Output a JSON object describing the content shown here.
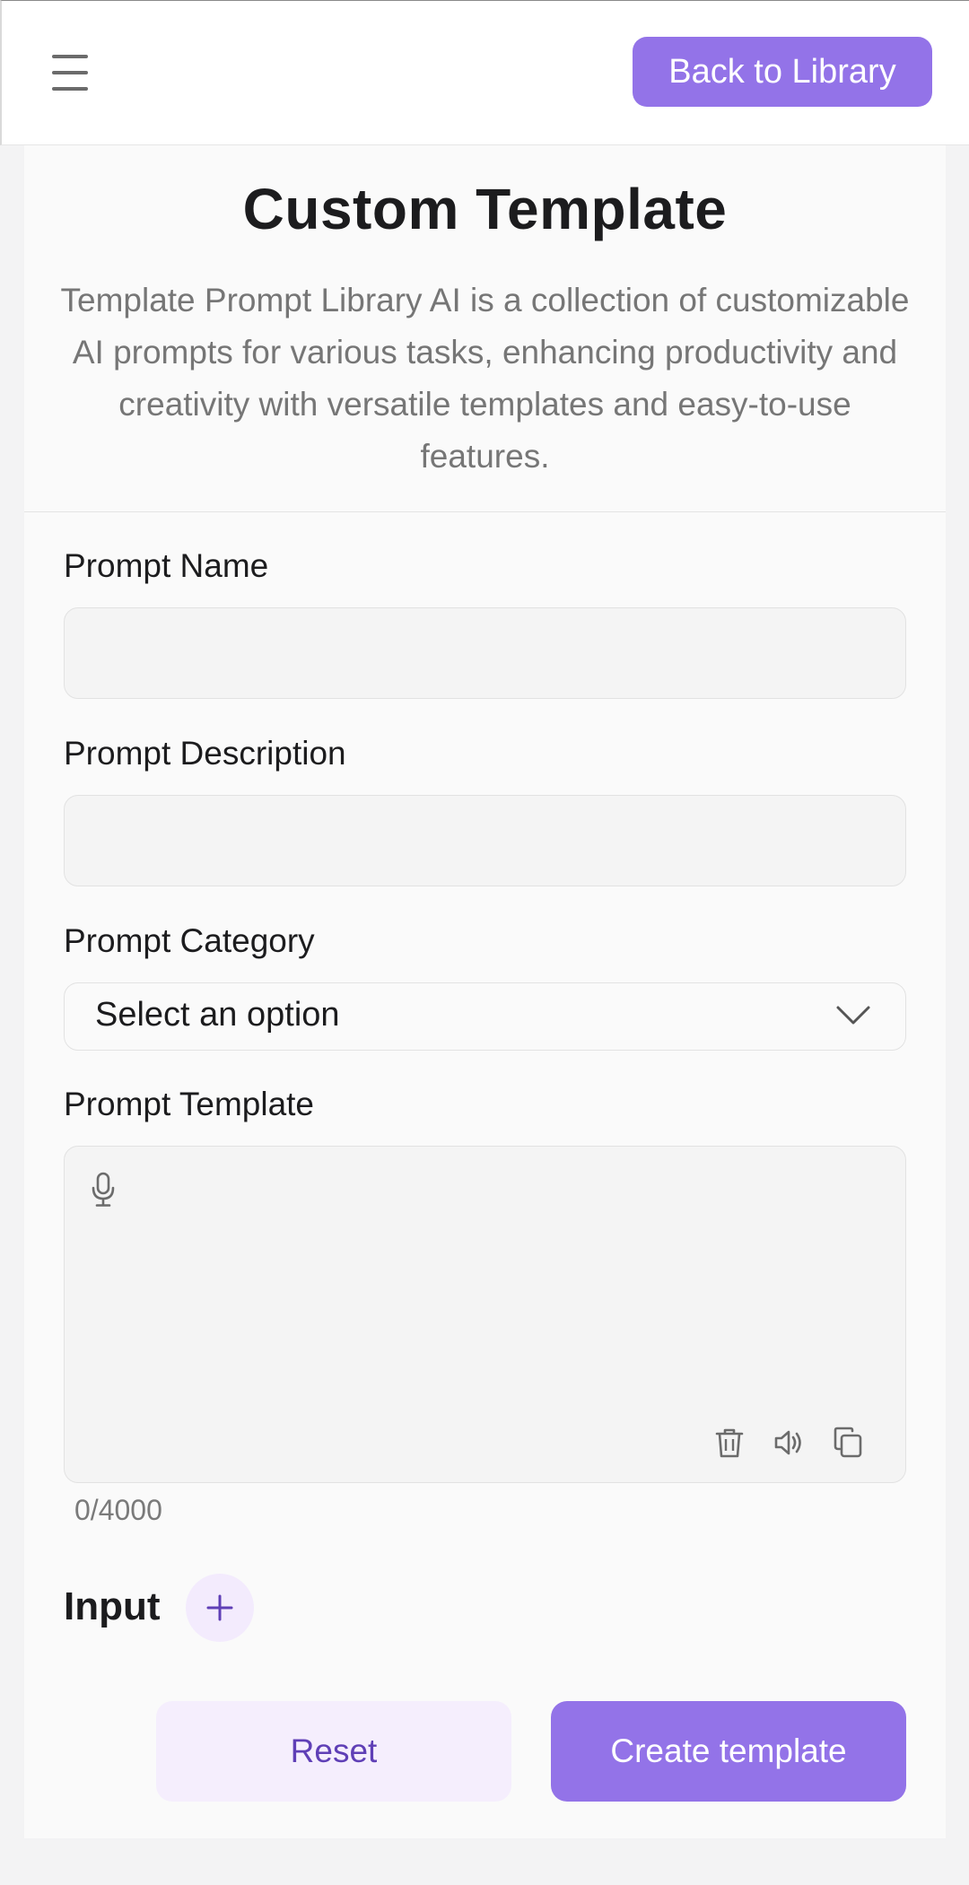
{
  "header": {
    "menu_icon": "hamburger-menu-icon",
    "back_button_label": "Back to Library"
  },
  "page": {
    "title": "Custom Template",
    "description": "Template Prompt Library AI is a collection of customizable AI prompts for various tasks, enhancing productivity and creativity with versatile templates and easy-to-use features."
  },
  "form": {
    "prompt_name": {
      "label": "Prompt Name",
      "value": "",
      "placeholder": ""
    },
    "prompt_description": {
      "label": "Prompt Description",
      "value": "",
      "placeholder": ""
    },
    "prompt_category": {
      "label": "Prompt Category",
      "selected": "Select an option"
    },
    "prompt_template": {
      "label": "Prompt Template",
      "value": "",
      "counter": "0/4000",
      "icons": [
        "microphone-icon",
        "trash-icon",
        "speaker-icon",
        "copy-icon"
      ]
    },
    "input_section": {
      "title": "Input",
      "add_icon": "plus-icon"
    }
  },
  "actions": {
    "reset_label": "Reset",
    "create_label": "Create template"
  },
  "colors": {
    "accent": "#9373e8",
    "accent_soft": "#f5eefd",
    "accent_text": "#5f3fb6"
  }
}
